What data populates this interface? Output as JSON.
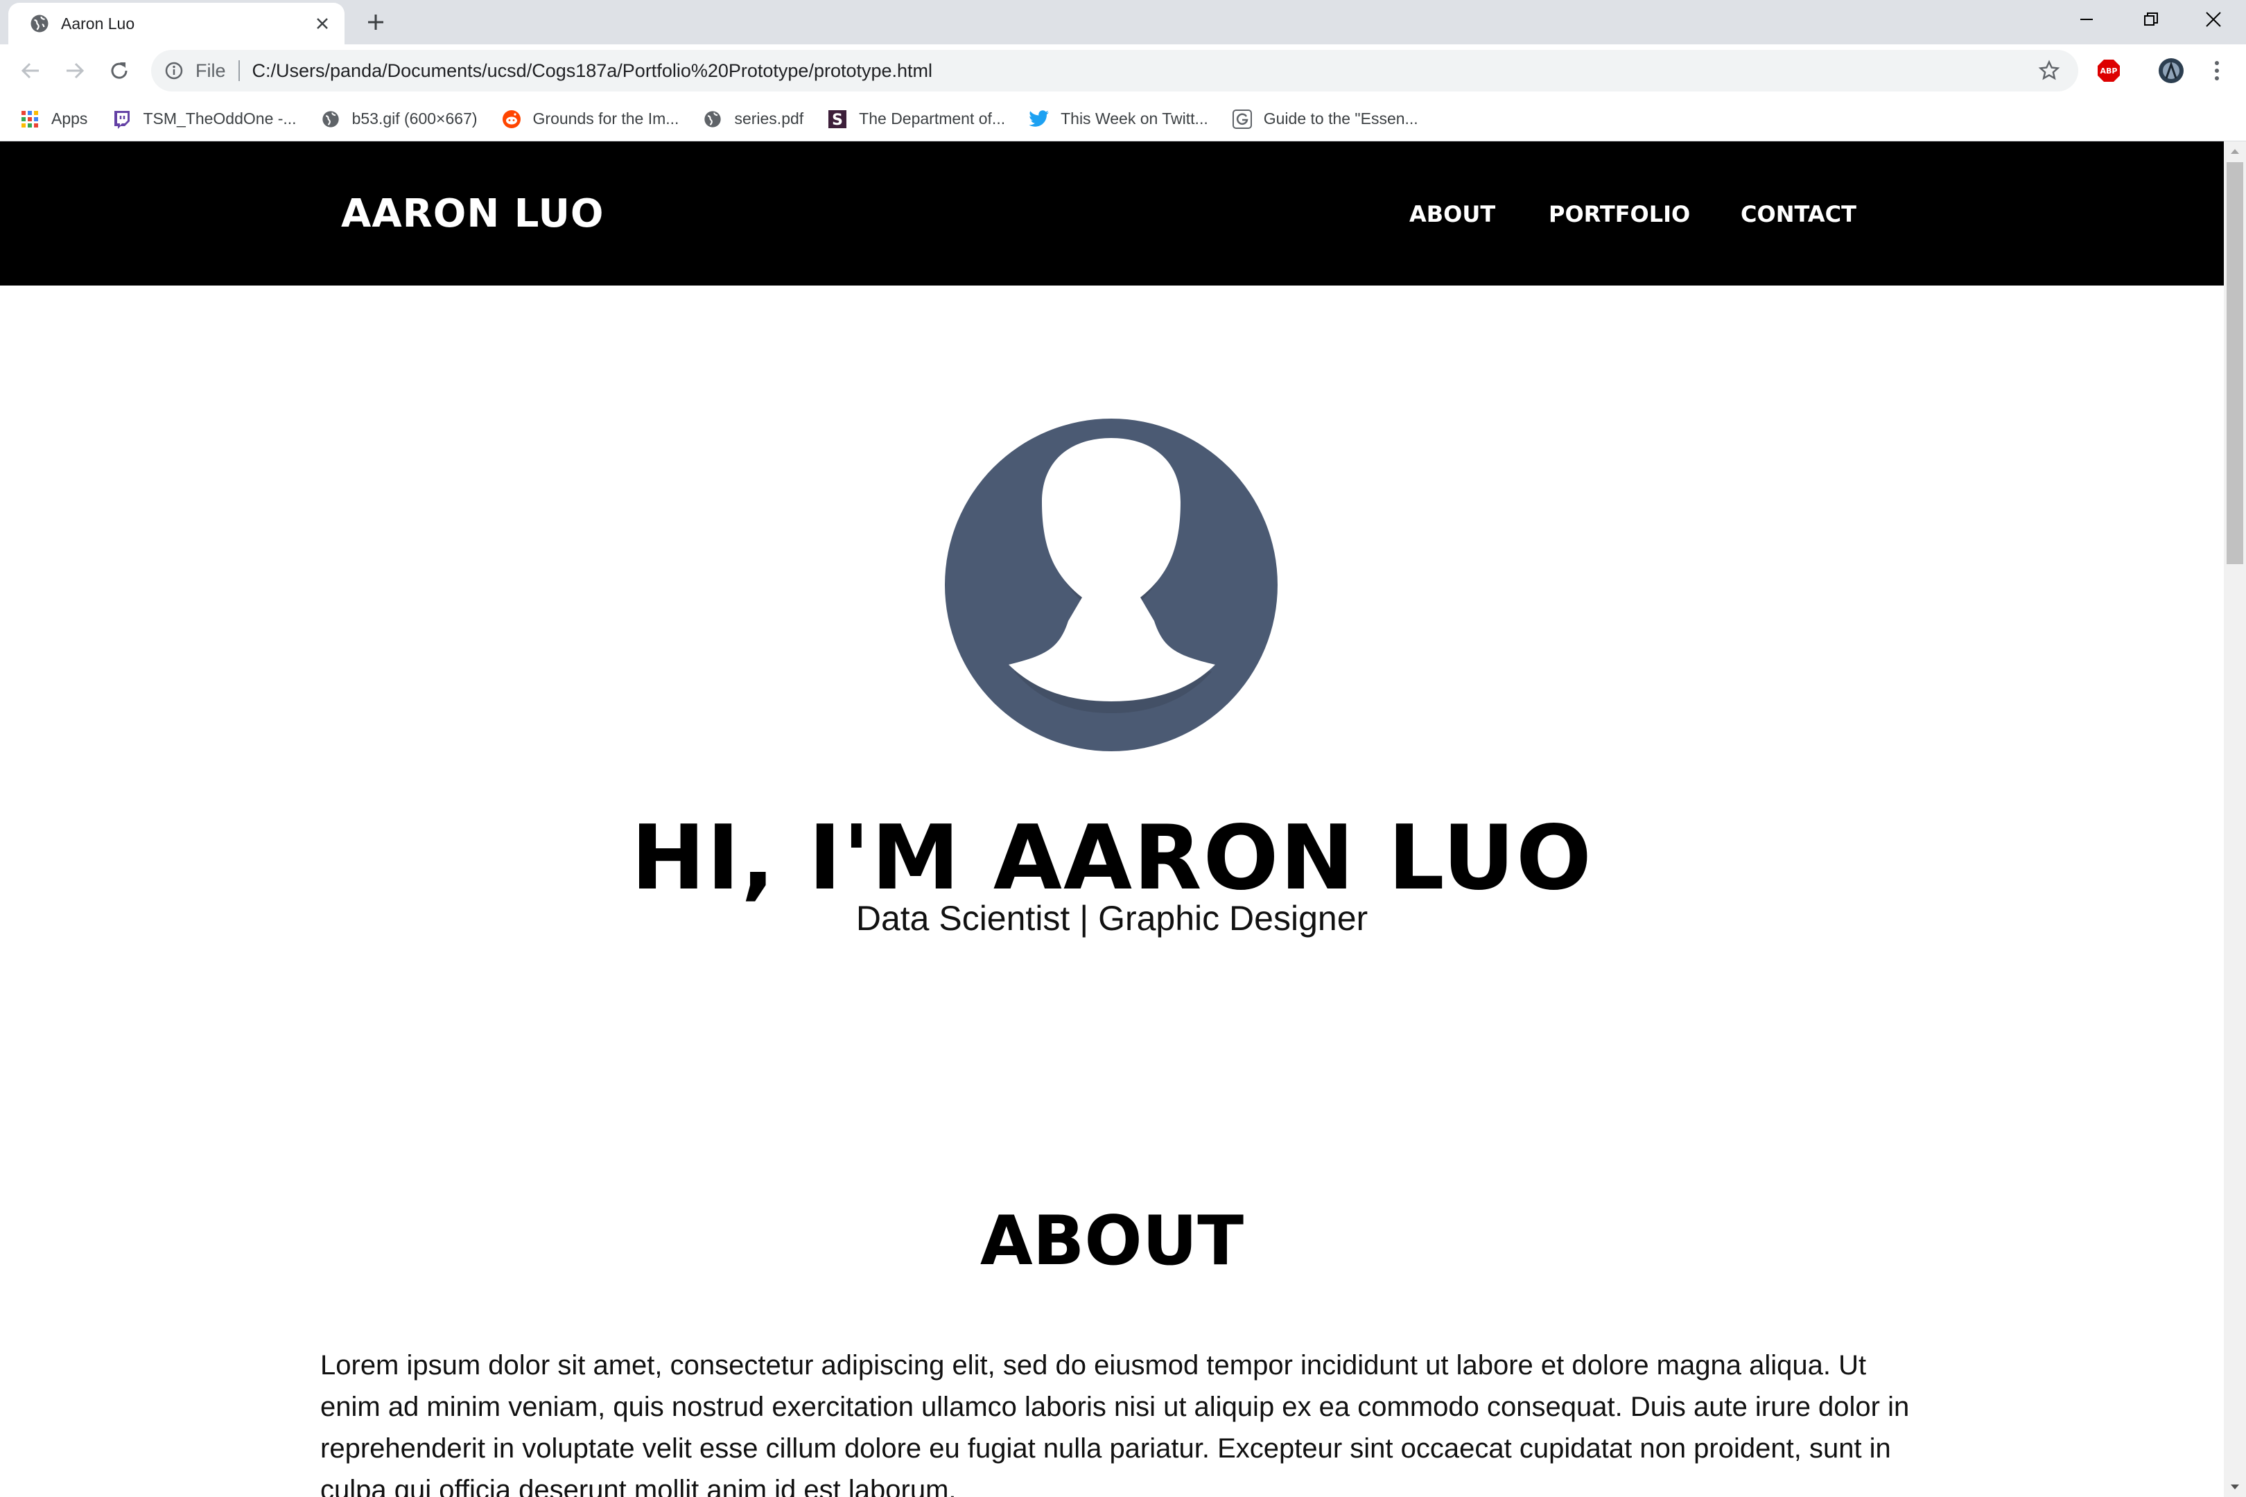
{
  "browser": {
    "tab_title": "Aaron Luo",
    "url_scheme": "File",
    "url": "C:/Users/panda/Documents/ucsd/Cogs187a/Portfolio%20Prototype/prototype.html",
    "extension_label": "ABP",
    "bookmarks": [
      {
        "label": "Apps",
        "icon": "apps-grid-icon"
      },
      {
        "label": "TSM_TheOddOne -...",
        "icon": "twitch-icon"
      },
      {
        "label": "b53.gif (600×667)",
        "icon": "globe-icon"
      },
      {
        "label": "Grounds for the Im...",
        "icon": "reddit-icon"
      },
      {
        "label": "series.pdf",
        "icon": "globe-icon"
      },
      {
        "label": "The Department of...",
        "icon": "s-logo-icon"
      },
      {
        "label": "This Week on Twitt...",
        "icon": "twitter-icon"
      },
      {
        "label": "Guide to the \"Essen...",
        "icon": "g-logo-icon"
      }
    ]
  },
  "site": {
    "brand": "AARON LUO",
    "nav": [
      "ABOUT",
      "PORTFOLIO",
      "CONTACT"
    ],
    "hero_title": "HI, I'M AARON LUO",
    "hero_subtitle": "Data Scientist | Graphic Designer",
    "about_heading": "ABOUT",
    "about_text": "Lorem ipsum dolor sit amet, consectetur adipiscing elit, sed do eiusmod tempor incididunt ut labore et dolore magna aliqua. Ut enim ad minim veniam, quis nostrud exercitation ullamco laboris nisi ut aliquip ex ea commodo consequat. Duis aute irure dolor in reprehenderit in voluptate velit esse cillum dolore eu fugiat nulla pariatur. Excepteur sint occaecat cupidatat non proident, sunt in culpa qui officia deserunt mollit anim id est laborum."
  },
  "colors": {
    "nav_bg": "#000000",
    "avatar_bg": "#4b5a73",
    "avatar_fg": "#ffffff"
  }
}
